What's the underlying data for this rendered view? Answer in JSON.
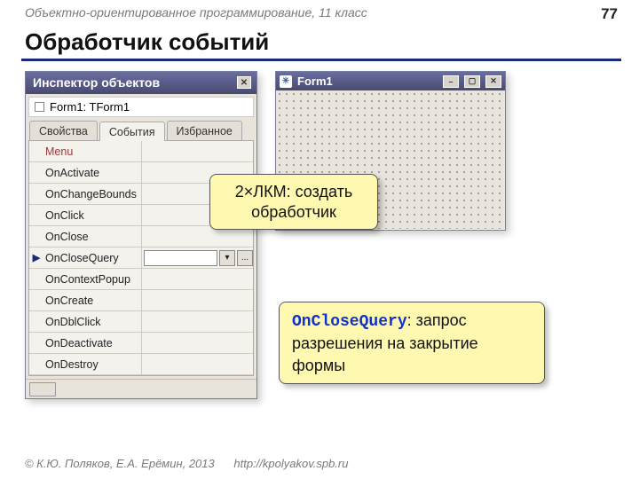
{
  "breadcrumb": "Объектно-ориентированное программирование, 11 класс",
  "page_number": "77",
  "page_title": "Обработчик событий",
  "inspector": {
    "title": "Инспектор объектов",
    "tree_item": "Form1: TForm1",
    "tabs": {
      "props": "Свойства",
      "events": "События",
      "fav": "Избранное"
    },
    "events": [
      {
        "name": "Menu"
      },
      {
        "name": "OnActivate"
      },
      {
        "name": "OnChangeBounds"
      },
      {
        "name": "OnClick"
      },
      {
        "name": "OnClose"
      },
      {
        "name": "OnCloseQuery",
        "selected": true
      },
      {
        "name": "OnContextPopup"
      },
      {
        "name": "OnCreate"
      },
      {
        "name": "OnDblClick"
      },
      {
        "name": "OnDeactivate"
      },
      {
        "name": "OnDestroy"
      }
    ],
    "dd_glyph": "▾",
    "dots": "..."
  },
  "form_designer": {
    "title": "Form1",
    "paw_glyph": "✳"
  },
  "callout_hint_line1": "2×ЛКМ: создать",
  "callout_hint_line2": "обработчик",
  "callout_desc_code": "OnCloseQuery",
  "callout_desc_rest": ": запрос разрешения на закрытие формы",
  "footer": {
    "copyright": "© К.Ю. Поляков, Е.А. Ерёмин, 2013",
    "url": "http://kpolyakov.spb.ru"
  }
}
